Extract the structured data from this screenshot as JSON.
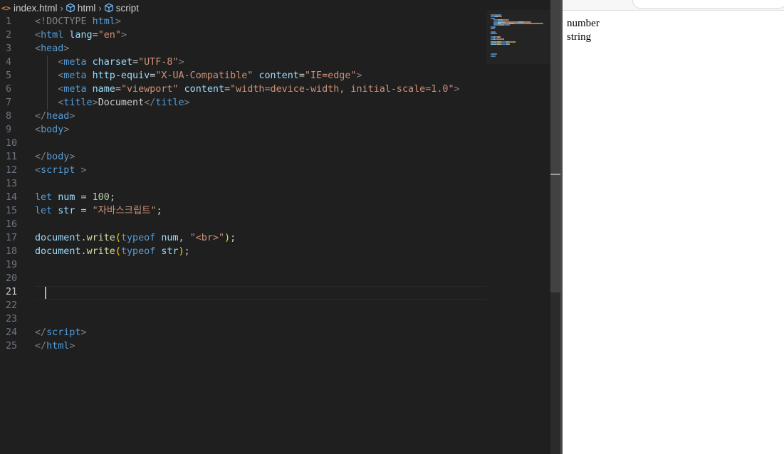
{
  "breadcrumb": {
    "file": "index.html",
    "seg1": "html",
    "seg2": "script",
    "file_icon": "<>"
  },
  "editor": {
    "active_line": 21,
    "lines": [
      [
        {
          "t": "<!DOCTYPE ",
          "c": "t-tag"
        },
        {
          "t": "html",
          "c": "t-name"
        },
        {
          "t": ">",
          "c": "t-tag"
        }
      ],
      [
        {
          "t": "<",
          "c": "t-tag"
        },
        {
          "t": "html ",
          "c": "t-name"
        },
        {
          "t": "lang",
          "c": "t-attr"
        },
        {
          "t": "=",
          "c": "t-txt"
        },
        {
          "t": "\"en\"",
          "c": "t-str"
        },
        {
          "t": ">",
          "c": "t-tag"
        }
      ],
      [
        {
          "t": "<",
          "c": "t-tag"
        },
        {
          "t": "head",
          "c": "t-name"
        },
        {
          "t": ">",
          "c": "t-tag"
        }
      ],
      [
        {
          "t": "    <",
          "c": "t-tag"
        },
        {
          "t": "meta ",
          "c": "t-name"
        },
        {
          "t": "charset",
          "c": "t-attr"
        },
        {
          "t": "=",
          "c": "t-txt"
        },
        {
          "t": "\"UTF-8\"",
          "c": "t-str"
        },
        {
          "t": ">",
          "c": "t-tag"
        }
      ],
      [
        {
          "t": "    <",
          "c": "t-tag"
        },
        {
          "t": "meta ",
          "c": "t-name"
        },
        {
          "t": "http-equiv",
          "c": "t-attr"
        },
        {
          "t": "=",
          "c": "t-txt"
        },
        {
          "t": "\"X-UA-Compatible\" ",
          "c": "t-str"
        },
        {
          "t": "content",
          "c": "t-attr"
        },
        {
          "t": "=",
          "c": "t-txt"
        },
        {
          "t": "\"IE=edge\"",
          "c": "t-str"
        },
        {
          "t": ">",
          "c": "t-tag"
        }
      ],
      [
        {
          "t": "    <",
          "c": "t-tag"
        },
        {
          "t": "meta ",
          "c": "t-name"
        },
        {
          "t": "name",
          "c": "t-attr"
        },
        {
          "t": "=",
          "c": "t-txt"
        },
        {
          "t": "\"viewport\" ",
          "c": "t-str"
        },
        {
          "t": "content",
          "c": "t-attr"
        },
        {
          "t": "=",
          "c": "t-txt"
        },
        {
          "t": "\"width=device-width, initial-scale=1.0\"",
          "c": "t-str"
        },
        {
          "t": ">",
          "c": "t-tag"
        }
      ],
      [
        {
          "t": "    <",
          "c": "t-tag"
        },
        {
          "t": "title",
          "c": "t-name"
        },
        {
          "t": ">",
          "c": "t-tag"
        },
        {
          "t": "Document",
          "c": "t-txt"
        },
        {
          "t": "</",
          "c": "t-tag"
        },
        {
          "t": "title",
          "c": "t-name"
        },
        {
          "t": ">",
          "c": "t-tag"
        }
      ],
      [
        {
          "t": "</",
          "c": "t-tag"
        },
        {
          "t": "head",
          "c": "t-name"
        },
        {
          "t": ">",
          "c": "t-tag"
        }
      ],
      [
        {
          "t": "<",
          "c": "t-tag"
        },
        {
          "t": "body",
          "c": "t-name"
        },
        {
          "t": ">",
          "c": "t-tag"
        }
      ],
      [],
      [
        {
          "t": "</",
          "c": "t-tag"
        },
        {
          "t": "body",
          "c": "t-name"
        },
        {
          "t": ">",
          "c": "t-tag"
        }
      ],
      [
        {
          "t": "<",
          "c": "t-tag"
        },
        {
          "t": "script ",
          "c": "t-name"
        },
        {
          "t": ">",
          "c": "t-tag"
        }
      ],
      [],
      [
        {
          "t": "let ",
          "c": "t-kw"
        },
        {
          "t": "num",
          "c": "t-var"
        },
        {
          "t": " = ",
          "c": "t-txt"
        },
        {
          "t": "100",
          "c": "t-num"
        },
        {
          "t": ";",
          "c": "t-txt"
        }
      ],
      [
        {
          "t": "let ",
          "c": "t-kw"
        },
        {
          "t": "str",
          "c": "t-var"
        },
        {
          "t": " = ",
          "c": "t-txt"
        },
        {
          "t": "\"자바스크립트\"",
          "c": "t-str"
        },
        {
          "t": ";",
          "c": "t-txt"
        }
      ],
      [],
      [
        {
          "t": "document",
          "c": "t-var"
        },
        {
          "t": ".",
          "c": "t-txt"
        },
        {
          "t": "write",
          "c": "t-fn"
        },
        {
          "t": "(",
          "c": "t-yellow"
        },
        {
          "t": "typeof ",
          "c": "t-kw"
        },
        {
          "t": "num",
          "c": "t-var"
        },
        {
          "t": ", ",
          "c": "t-txt"
        },
        {
          "t": "\"<br>\"",
          "c": "t-str"
        },
        {
          "t": ")",
          "c": "t-yellow"
        },
        {
          "t": ";",
          "c": "t-txt"
        }
      ],
      [
        {
          "t": "document",
          "c": "t-var"
        },
        {
          "t": ".",
          "c": "t-txt"
        },
        {
          "t": "write",
          "c": "t-fn"
        },
        {
          "t": "(",
          "c": "t-yellow"
        },
        {
          "t": "typeof ",
          "c": "t-kw"
        },
        {
          "t": "str",
          "c": "t-var"
        },
        {
          "t": ")",
          "c": "t-yellow"
        },
        {
          "t": ";",
          "c": "t-txt"
        }
      ],
      [],
      [],
      [],
      [],
      [],
      [
        {
          "t": "</",
          "c": "t-tag"
        },
        {
          "t": "script",
          "c": "t-name"
        },
        {
          "t": ">",
          "c": "t-tag"
        }
      ],
      [
        {
          "t": "</",
          "c": "t-tag"
        },
        {
          "t": "html",
          "c": "t-name"
        },
        {
          "t": ">",
          "c": "t-tag"
        }
      ]
    ]
  },
  "browser": {
    "output": [
      "number",
      "string"
    ]
  },
  "colors": {
    "editor_bg": "#1f1f1f",
    "tag": "#808080",
    "keyword": "#569cd6",
    "string": "#ce9178"
  }
}
